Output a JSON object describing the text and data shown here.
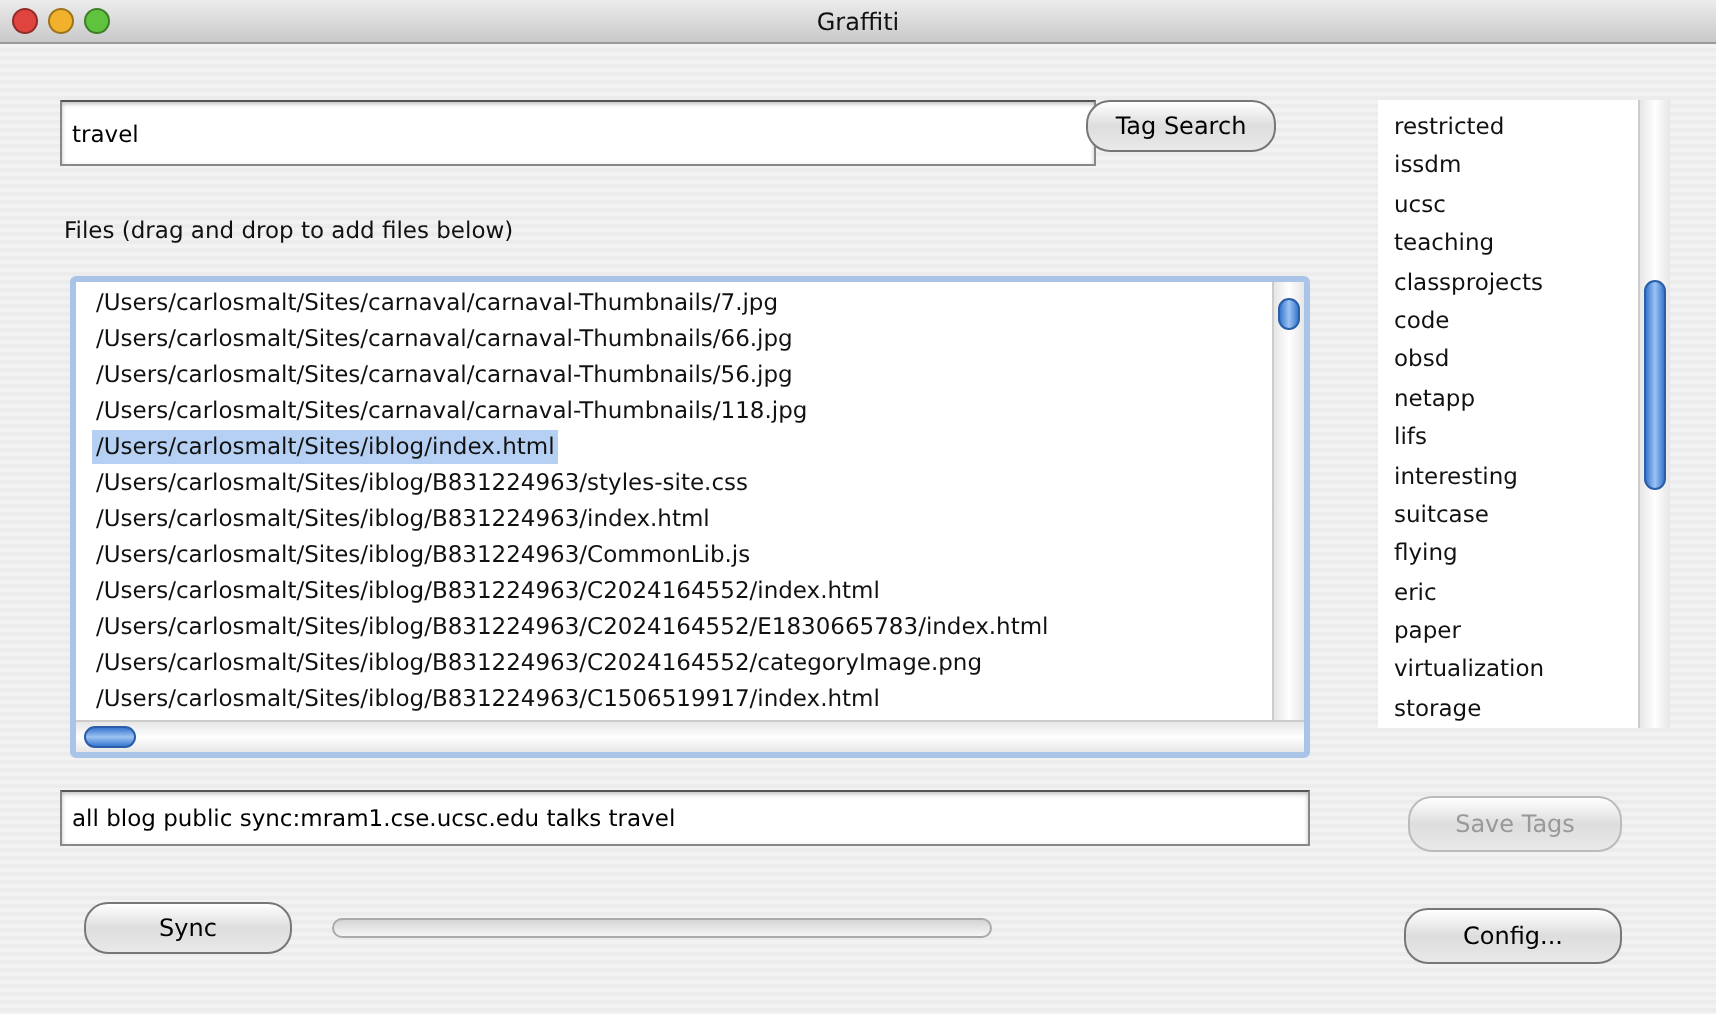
{
  "window": {
    "title": "Graffiti"
  },
  "search": {
    "value": "travel"
  },
  "tag_search_button": {
    "label": "Tag Search",
    "disabled": false
  },
  "files_label": "Files (drag and drop to add files below)",
  "files": [
    {
      "path": "/Users/carlosmalt/Sites/carnaval/carnaval-Thumbnails/7.jpg",
      "selected": false
    },
    {
      "path": "/Users/carlosmalt/Sites/carnaval/carnaval-Thumbnails/66.jpg",
      "selected": false
    },
    {
      "path": "/Users/carlosmalt/Sites/carnaval/carnaval-Thumbnails/56.jpg",
      "selected": false
    },
    {
      "path": "/Users/carlosmalt/Sites/carnaval/carnaval-Thumbnails/118.jpg",
      "selected": false
    },
    {
      "path": "/Users/carlosmalt/Sites/iblog/index.html",
      "selected": true
    },
    {
      "path": "/Users/carlosmalt/Sites/iblog/B831224963/styles-site.css",
      "selected": false
    },
    {
      "path": "/Users/carlosmalt/Sites/iblog/B831224963/index.html",
      "selected": false
    },
    {
      "path": "/Users/carlosmalt/Sites/iblog/B831224963/CommonLib.js",
      "selected": false
    },
    {
      "path": "/Users/carlosmalt/Sites/iblog/B831224963/C2024164552/index.html",
      "selected": false
    },
    {
      "path": "/Users/carlosmalt/Sites/iblog/B831224963/C2024164552/E1830665783/index.html",
      "selected": false
    },
    {
      "path": "/Users/carlosmalt/Sites/iblog/B831224963/C2024164552/categoryImage.png",
      "selected": false
    },
    {
      "path": "/Users/carlosmalt/Sites/iblog/B831224963/C1506519917/index.html",
      "selected": false
    }
  ],
  "tags": [
    "restricted",
    "issdm",
    "ucsc",
    "teaching",
    "classprojects",
    "code",
    "obsd",
    "netapp",
    "lifs",
    "interesting",
    "suitcase",
    "flying",
    "eric",
    "paper",
    "virtualization",
    "storage"
  ],
  "tags_field": {
    "value": "all blog public sync:mram1.cse.ucsc.edu talks travel"
  },
  "save_tags_button": {
    "label": "Save Tags",
    "disabled": true
  },
  "sync_button": {
    "label": "Sync",
    "disabled": false
  },
  "sync_progress": {
    "level": 0
  },
  "config_button": {
    "label": "Config...",
    "disabled": false
  }
}
